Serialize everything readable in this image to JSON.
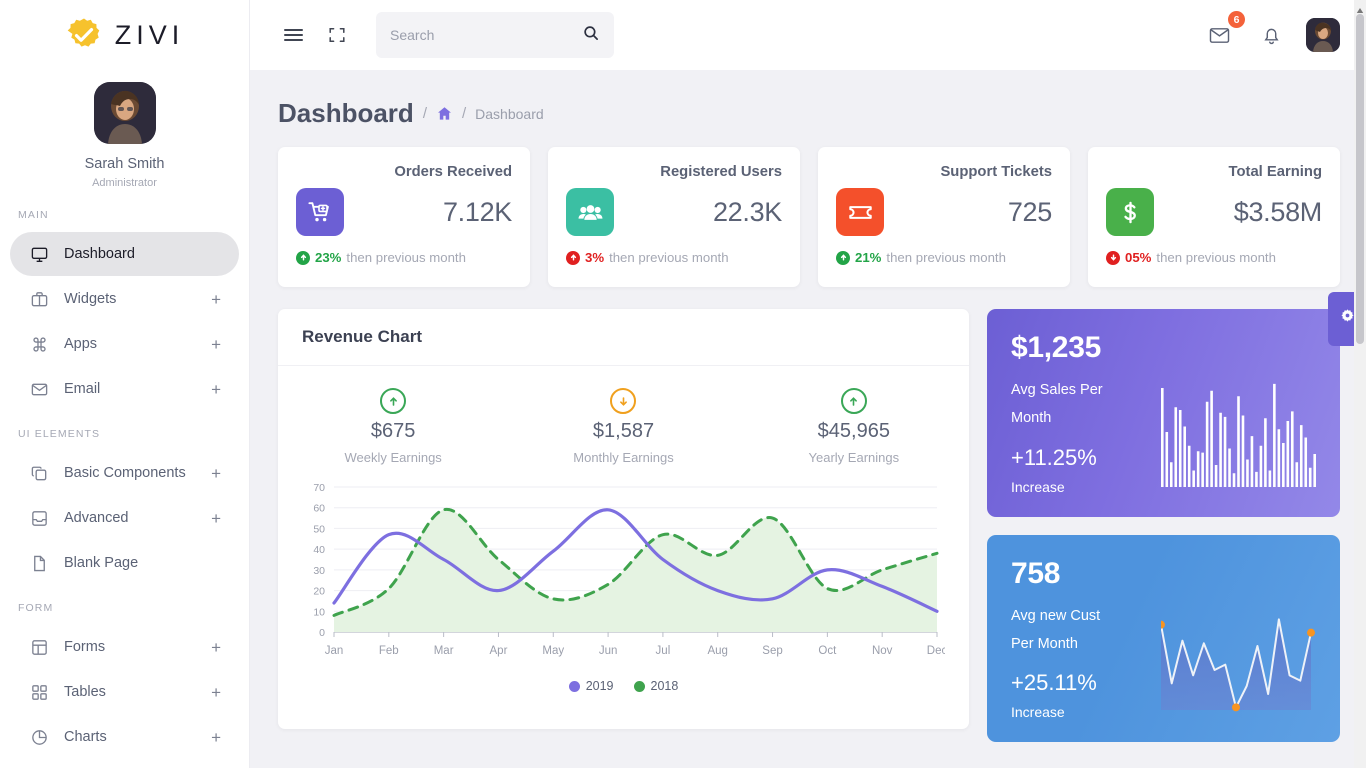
{
  "brand": {
    "name": "ZIVI",
    "logo_icon": "gear-check-logo"
  },
  "profile": {
    "name": "Sarah Smith",
    "role": "Administrator",
    "avatar_icon": "user-avatar"
  },
  "sidebar": {
    "sections": [
      {
        "label": "MAIN",
        "items": [
          {
            "label": "Dashboard",
            "icon": "monitor-icon",
            "expandable": false,
            "active": true
          },
          {
            "label": "Widgets",
            "icon": "briefcase-icon",
            "expandable": true,
            "active": false
          },
          {
            "label": "Apps",
            "icon": "command-icon",
            "expandable": true,
            "active": false
          },
          {
            "label": "Email",
            "icon": "mail-icon",
            "expandable": true,
            "active": false
          }
        ]
      },
      {
        "label": "UI ELEMENTS",
        "items": [
          {
            "label": "Basic Components",
            "icon": "copy-icon",
            "expandable": true,
            "active": false
          },
          {
            "label": "Advanced",
            "icon": "inbox-icon",
            "expandable": true,
            "active": false
          },
          {
            "label": "Blank Page",
            "icon": "file-icon",
            "expandable": false,
            "active": false
          }
        ]
      },
      {
        "label": "FORM",
        "items": [
          {
            "label": "Forms",
            "icon": "layout-icon",
            "expandable": true,
            "active": false
          },
          {
            "label": "Tables",
            "icon": "grid-icon",
            "expandable": true,
            "active": false
          },
          {
            "label": "Charts",
            "icon": "pie-chart-icon",
            "expandable": true,
            "active": false
          }
        ]
      }
    ],
    "expand_symbol": "+"
  },
  "topbar": {
    "menu_icon": "hamburger-icon",
    "fullscreen_icon": "fullscreen-icon",
    "search": {
      "placeholder": "Search",
      "value": "",
      "icon": "search-icon"
    },
    "mail_icon": "mail-icon",
    "mail_badge": "6",
    "bell_icon": "bell-icon",
    "avatar_icon": "user-avatar"
  },
  "page": {
    "title": "Dashboard",
    "breadcrumb": {
      "sep": "/",
      "home_icon": "home-icon",
      "current": "Dashboard"
    }
  },
  "stats": [
    {
      "title": "Orders Received",
      "value": "7.12K",
      "icon": "shopping-cart-plus-icon",
      "icon_bg": "#6c5fd4",
      "pct": "23%",
      "pct_color": "#22a447",
      "trend": "up",
      "trend_color": "#22a447",
      "note": "then previous month"
    },
    {
      "title": "Registered Users",
      "value": "22.3K",
      "icon": "users-icon",
      "icon_bg": "#3bbfa3",
      "pct": "3%",
      "pct_color": "#e02020",
      "trend": "up",
      "trend_color": "#e02020",
      "note": "then previous month"
    },
    {
      "title": "Support Tickets",
      "value": "725",
      "icon": "ticket-icon",
      "icon_bg": "#f4502b",
      "pct": "21%",
      "pct_color": "#22a447",
      "trend": "up",
      "trend_color": "#22a447",
      "note": "then previous month"
    },
    {
      "title": "Total Earning",
      "value": "$3.58M",
      "icon": "dollar-icon",
      "icon_bg": "#49b04a",
      "pct": "05%",
      "pct_color": "#e02020",
      "trend": "down",
      "trend_color": "#e02020",
      "note": "then previous month"
    }
  ],
  "revenue": {
    "title": "Revenue Chart",
    "earnings": [
      {
        "value": "$675",
        "label": "Weekly Earnings",
        "trend": "up",
        "color": "#3aa757"
      },
      {
        "value": "$1,587",
        "label": "Monthly Earnings",
        "trend": "down",
        "color": "#f0a01e"
      },
      {
        "value": "$45,965",
        "label": "Yearly Earnings",
        "trend": "up",
        "color": "#3aa757"
      }
    ]
  },
  "chart_data": {
    "type": "line",
    "title": "Revenue Chart",
    "xlabel": "",
    "ylabel": "",
    "ylim": [
      0,
      70
    ],
    "yticks": [
      0,
      10,
      20,
      30,
      40,
      50,
      60,
      70
    ],
    "grid": true,
    "legend_position": "bottom",
    "categories": [
      "Jan",
      "Feb",
      "Mar",
      "Apr",
      "May",
      "Jun",
      "Jul",
      "Aug",
      "Sep",
      "Oct",
      "Nov",
      "Dec"
    ],
    "series": [
      {
        "name": "2019",
        "color": "#7d6fe0",
        "style": "solid",
        "fill": false,
        "values": [
          14,
          47,
          35,
          20,
          39,
          59,
          35,
          20,
          16,
          30,
          22,
          10
        ]
      },
      {
        "name": "2018",
        "color": "#3fa34d",
        "style": "dashed",
        "fill": true,
        "fill_color": "#e5f3e2",
        "values": [
          8,
          21,
          59,
          35,
          16,
          23,
          47,
          37,
          55,
          21,
          30,
          38
        ]
      }
    ]
  },
  "widgets": [
    {
      "id": "avg-sales",
      "value": "$1,235",
      "line1": "Avg Sales Per",
      "line2": "Month",
      "pct": "+11.25%",
      "pct_label": "Increase",
      "accent": "#6c5fd4",
      "graphic": "bar-sparkline",
      "graphic_values": [
        72,
        40,
        18,
        58,
        56,
        44,
        30,
        12,
        26,
        25,
        62,
        70,
        16,
        54,
        51,
        28,
        10,
        66,
        52,
        20,
        37,
        11,
        30,
        50,
        12,
        75,
        42,
        32,
        48,
        55,
        18,
        45,
        36,
        14,
        24
      ]
    },
    {
      "id": "avg-new-cust",
      "value": "758",
      "line1": "Avg new Cust",
      "line2": "Per Month",
      "pct": "+25.11%",
      "pct_label": "Increase",
      "accent": "#4e93dd",
      "graphic": "line-sparkline",
      "graphic_values": [
        64,
        20,
        52,
        26,
        50,
        30,
        34,
        2,
        18,
        48,
        12,
        68,
        26,
        22,
        58
      ],
      "marker_color": "#f79421"
    }
  ],
  "settings_fab": {
    "icon": "gear-icon"
  }
}
